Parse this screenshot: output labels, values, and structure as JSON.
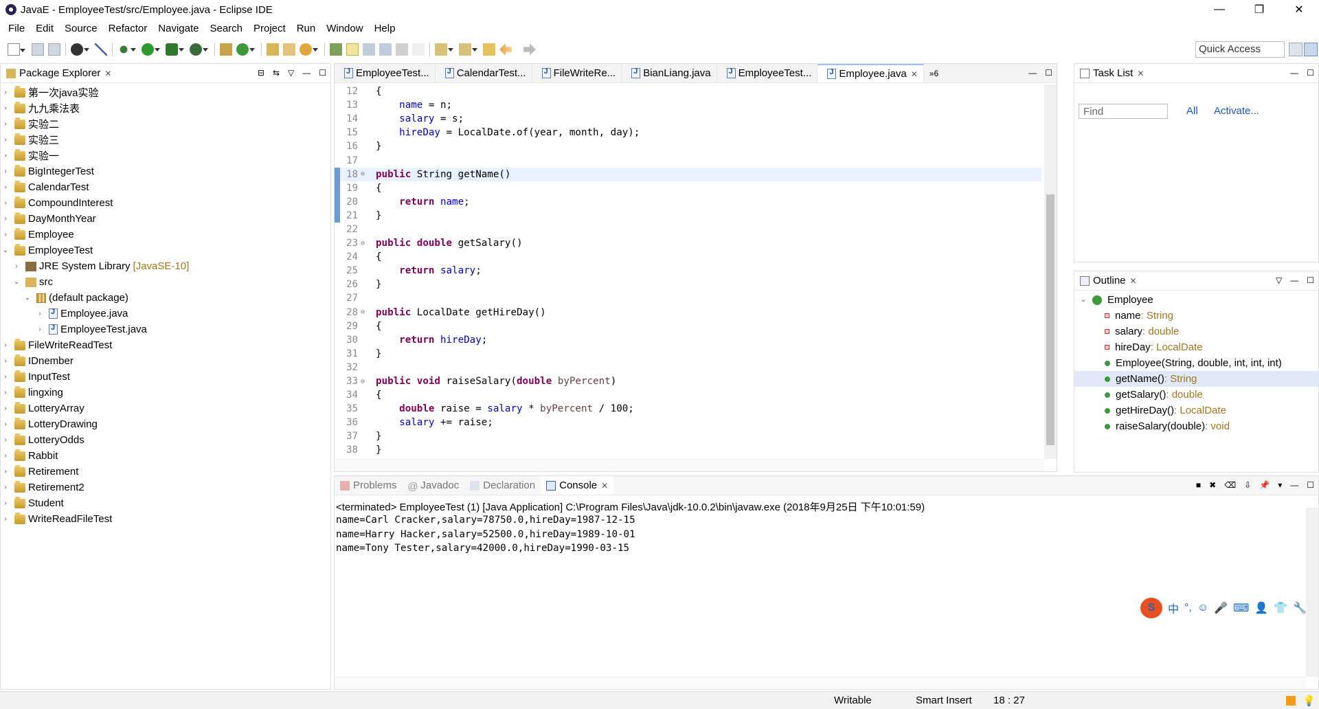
{
  "window": {
    "title": "JavaE - EmployeeTest/src/Employee.java - Eclipse IDE",
    "controls": [
      "—",
      "❐",
      "✕"
    ]
  },
  "menu": [
    "File",
    "Edit",
    "Source",
    "Refactor",
    "Navigate",
    "Search",
    "Project",
    "Run",
    "Window",
    "Help"
  ],
  "quick_access": "Quick Access",
  "package_explorer": {
    "title": "Package Explorer",
    "projects_top": [
      "第一次java实验",
      "九九乘法表",
      "实验二",
      "实验三",
      "实验一",
      "BigIntegerTest",
      "CalendarTest",
      "CompoundInterest",
      "DayMonthYear",
      "Employee"
    ],
    "open_project": "EmployeeTest",
    "jre": "JRE System Library",
    "jre_version": "[JavaSE-10]",
    "src": "src",
    "package": "(default package)",
    "files": [
      "Employee.java",
      "EmployeeTest.java"
    ],
    "projects_bottom": [
      "FileWriteReadTest",
      "IDnember",
      "InputTest",
      "lingxing",
      "LotteryArray",
      "LotteryDrawing",
      "LotteryOdds",
      "Rabbit",
      "Retirement",
      "Retirement2",
      "Student",
      "WriteReadFileTest"
    ]
  },
  "editor": {
    "tabs": [
      "EmployeeTest...",
      "CalendarTest...",
      "FileWriteRe...",
      "BianLiang.java",
      "EmployeeTest...",
      "Employee.java"
    ],
    "overflow": "»6",
    "lines": [
      {
        "n": "12",
        "code": "{"
      },
      {
        "n": "13",
        "code": "    name = n;"
      },
      {
        "n": "14",
        "code": "    salary = s;"
      },
      {
        "n": "15",
        "code": "    hireDay = LocalDate.of(year, month, day);"
      },
      {
        "n": "16",
        "code": "}"
      },
      {
        "n": "17",
        "code": ""
      },
      {
        "n": "18",
        "code": "public String getName()"
      },
      {
        "n": "19",
        "code": "{"
      },
      {
        "n": "20",
        "code": "    return name;"
      },
      {
        "n": "21",
        "code": "}"
      },
      {
        "n": "22",
        "code": ""
      },
      {
        "n": "23",
        "code": "public double getSalary()"
      },
      {
        "n": "24",
        "code": "{"
      },
      {
        "n": "25",
        "code": "    return salary;"
      },
      {
        "n": "26",
        "code": "}"
      },
      {
        "n": "27",
        "code": ""
      },
      {
        "n": "28",
        "code": "public LocalDate getHireDay()"
      },
      {
        "n": "29",
        "code": "{"
      },
      {
        "n": "30",
        "code": "    return hireDay;"
      },
      {
        "n": "31",
        "code": "}"
      },
      {
        "n": "32",
        "code": ""
      },
      {
        "n": "33",
        "code": "public void raiseSalary(double byPercent)"
      },
      {
        "n": "34",
        "code": "{"
      },
      {
        "n": "35",
        "code": "    double raise = salary * byPercent / 100;"
      },
      {
        "n": "36",
        "code": "    salary += raise;"
      },
      {
        "n": "37",
        "code": "}"
      },
      {
        "n": "38",
        "code": "}"
      }
    ]
  },
  "task_list": {
    "title": "Task List",
    "find_placeholder": "Find",
    "all": "All",
    "activate": "Activate..."
  },
  "outline": {
    "title": "Outline",
    "class": "Employee",
    "members": [
      {
        "name": "name",
        "type": " : String",
        "kind": "field"
      },
      {
        "name": "salary",
        "type": " : double",
        "kind": "field"
      },
      {
        "name": "hireDay",
        "type": " : LocalDate",
        "kind": "field"
      },
      {
        "name": "Employee(String, double, int, int, int)",
        "type": "",
        "kind": "ctor"
      },
      {
        "name": "getName()",
        "type": " : String",
        "kind": "method"
      },
      {
        "name": "getSalary()",
        "type": " : double",
        "kind": "method"
      },
      {
        "name": "getHireDay()",
        "type": " : LocalDate",
        "kind": "method"
      },
      {
        "name": "raiseSalary(double)",
        "type": " : void",
        "kind": "method"
      }
    ]
  },
  "bottom_tabs": [
    "Problems",
    "Javadoc",
    "Declaration",
    "Console"
  ],
  "console": {
    "header": "<terminated> EmployeeTest (1) [Java Application] C:\\Program Files\\Java\\jdk-10.0.2\\bin\\javaw.exe (2018年9月25日 下午10:01:59)",
    "output": [
      "name=Carl Cracker,salary=78750.0,hireDay=1987-12-15",
      "name=Harry Hacker,salary=52500.0,hireDay=1989-10-01",
      "name=Tony Tester,salary=42000.0,hireDay=1990-03-15"
    ]
  },
  "status": {
    "writable": "Writable",
    "insert": "Smart Insert",
    "position": "18 : 27"
  },
  "ime": {
    "logo": "S",
    "lang": "中",
    "punct": "°,"
  },
  "colors": {
    "keyword": "#7f0055",
    "field": "#0000c0",
    "comment": "#3f7f5f",
    "selection": "#dfe9f7"
  }
}
